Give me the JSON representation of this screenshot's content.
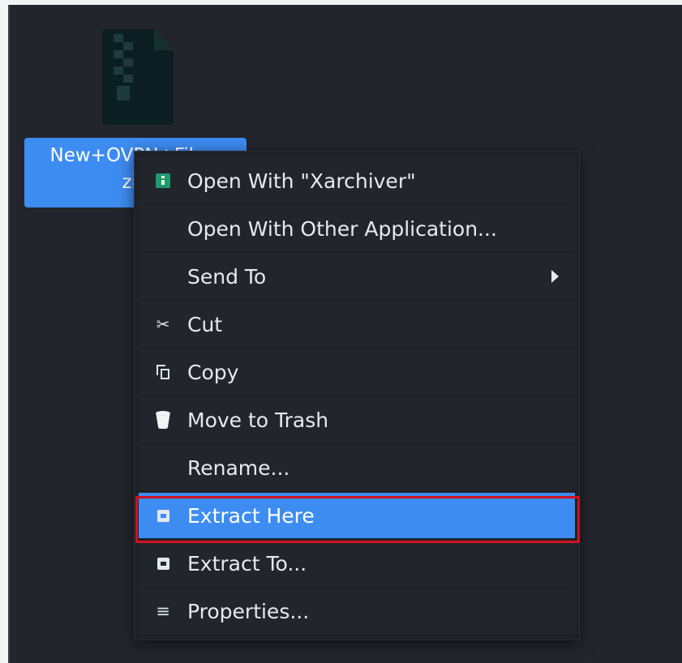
{
  "file": {
    "name_line1": "New+OVPN+Files.",
    "name_line2": "zip",
    "icon": "zip-archive-icon"
  },
  "menu": {
    "items": [
      {
        "label": "Open With \"Xarchiver\"",
        "icon": "xarchiver-app-icon"
      },
      {
        "label": "Open With Other Application...",
        "icon": ""
      },
      {
        "label": "Send To",
        "icon": "",
        "submenu": true
      },
      {
        "label": "Cut",
        "icon": "scissors-icon"
      },
      {
        "label": "Copy",
        "icon": "copy-icon"
      },
      {
        "label": "Move to Trash",
        "icon": "trash-icon"
      },
      {
        "label": "Rename...",
        "icon": ""
      },
      {
        "label": "Extract Here",
        "icon": "extract-icon",
        "active": true
      },
      {
        "label": "Extract To...",
        "icon": "extract-icon"
      },
      {
        "label": "Properties...",
        "icon": "properties-icon"
      }
    ]
  },
  "colors": {
    "desktop_bg": "#23252d",
    "menu_bg": "#1f2128",
    "accent": "#3d8cf2",
    "highlight_border": "#d0121f"
  }
}
